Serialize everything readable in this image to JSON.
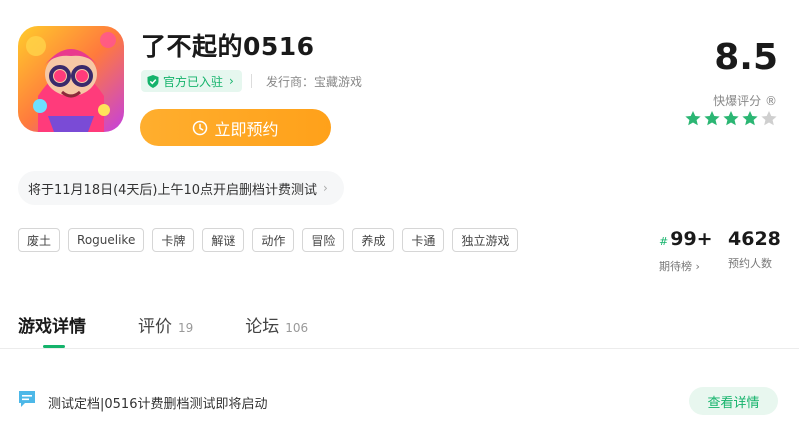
{
  "app": {
    "title": "了不起的0516",
    "official_badge": "官方已入驻",
    "official_chevron": "›",
    "publisher_label": "发行商：",
    "publisher_name": "宝藏游戏",
    "reserve_button": "立即预约"
  },
  "rating": {
    "score": "8.5",
    "label": "快爆评分 ®",
    "stars_full": 4,
    "stars_total": 5,
    "star_color": "#2bb673",
    "star_empty_color": "#cfcfcf"
  },
  "notice": {
    "text": "将于11月18日(4天后)上午10点开启删档计费测试",
    "chevron": "›"
  },
  "tags": [
    "废土",
    "Roguelike",
    "卡牌",
    "解谜",
    "动作",
    "冒险",
    "养成",
    "卡通",
    "独立游戏"
  ],
  "stats": {
    "rank_hash": "#",
    "rank_value": "99+",
    "rank_label": "期待榜 ›",
    "reservations_value": "4628",
    "reservations_label": "预约人数"
  },
  "tabs": [
    {
      "label": "游戏详情",
      "count": ""
    },
    {
      "label": "评价",
      "count": "19"
    },
    {
      "label": "论坛",
      "count": "106"
    }
  ],
  "news": {
    "icon": "message-icon",
    "text": "测试定档|0516计费删档测试即将启动",
    "button": "查看详情"
  },
  "colors": {
    "accent_green": "#14b36b",
    "accent_orange": "#ffa11a"
  }
}
